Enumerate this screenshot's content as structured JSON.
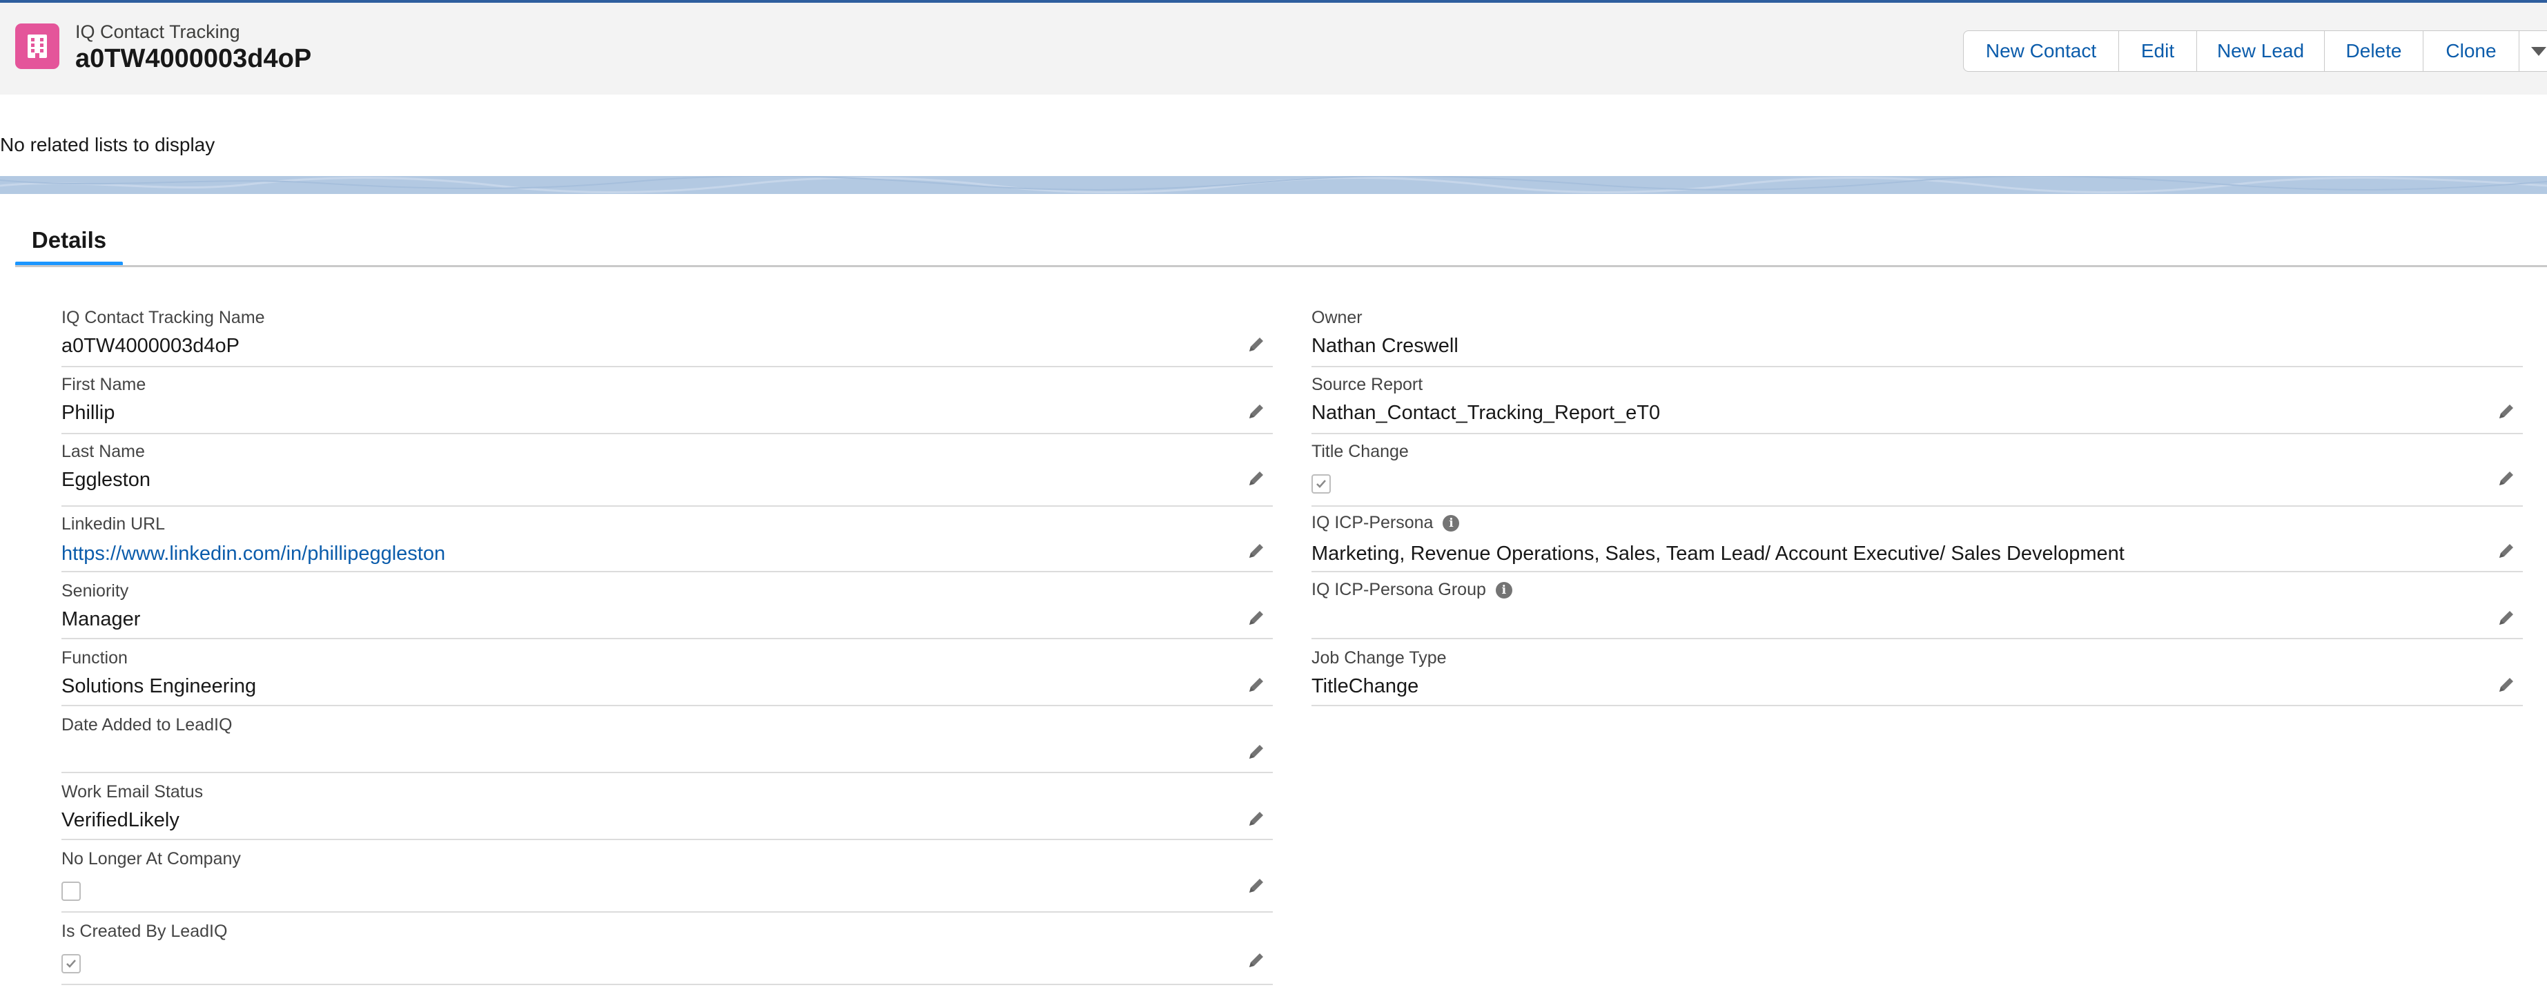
{
  "header": {
    "object_label": "IQ Contact Tracking",
    "record_title": "a0TW4000003d4oP",
    "icon": "building-icon",
    "accent": "#e4559a"
  },
  "actions": {
    "new_contact": "New Contact",
    "edit": "Edit",
    "new_lead": "New Lead",
    "delete": "Delete",
    "clone": "Clone",
    "more_icon": "chevron-down-icon"
  },
  "related": {
    "empty_text": "No related lists to display"
  },
  "tabs": {
    "details": "Details"
  },
  "left_fields": [
    {
      "label": "IQ Contact Tracking Name",
      "value": "a0TW4000003d4oP"
    },
    {
      "label": "First Name",
      "value": "Phillip"
    },
    {
      "label": "Last Name",
      "value": "Eggleston"
    },
    {
      "label": "Linkedin URL",
      "value": "https://www.linkedin.com/in/phillipeggleston"
    },
    {
      "label": "Seniority",
      "value": "Manager"
    },
    {
      "label": "Function",
      "value": "Solutions Engineering"
    },
    {
      "label": "Date Added to LeadIQ",
      "value": ""
    },
    {
      "label": "Work Email Status",
      "value": "VerifiedLikely"
    },
    {
      "label": "No Longer At Company",
      "checked": false
    },
    {
      "label": "Is Created By LeadIQ",
      "checked": true
    }
  ],
  "right_fields": [
    {
      "label": "Owner",
      "value": "Nathan Creswell"
    },
    {
      "label": "Source Report",
      "value": "Nathan_Contact_Tracking_Report_eT0"
    },
    {
      "label": "Title Change",
      "checked": true
    },
    {
      "label": "IQ ICP-Persona",
      "value": "Marketing, Revenue Operations, Sales, Team Lead/ Account Executive/ Sales Development"
    },
    {
      "label": "IQ ICP-Persona Group",
      "value": ""
    },
    {
      "label": "Job Change Type",
      "value": "TitleChange"
    }
  ]
}
